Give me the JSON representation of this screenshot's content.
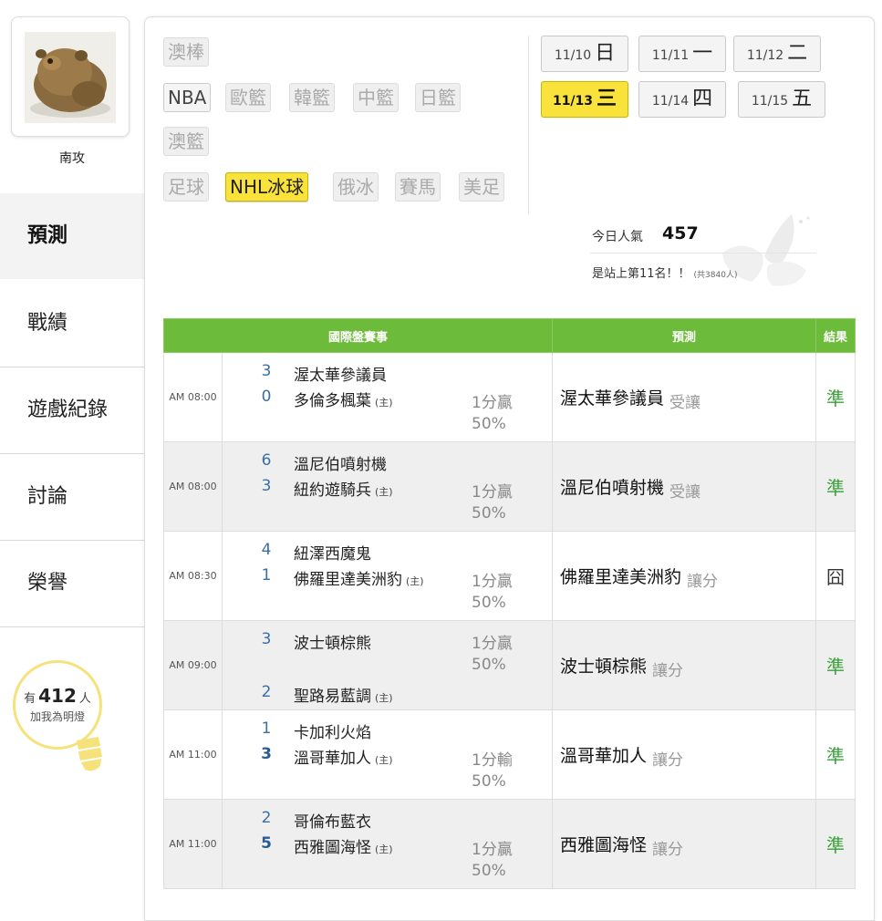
{
  "user": {
    "name": "南攻"
  },
  "nav": {
    "items": [
      {
        "label": "預測",
        "active": true
      },
      {
        "label": "戰績"
      },
      {
        "label": "遊戲紀錄"
      },
      {
        "label": "討論"
      },
      {
        "label": "榮譽"
      }
    ]
  },
  "fans": {
    "prefix": "有",
    "count": "412",
    "suffix": "人",
    "text": "加我為明燈"
  },
  "sports": {
    "tags": [
      {
        "label": "澳棒",
        "state": "off"
      },
      {
        "label": "NBA",
        "state": "on"
      },
      {
        "label": "歐籃",
        "state": "off"
      },
      {
        "label": "韓籃",
        "state": "off"
      },
      {
        "label": "中籃",
        "state": "off"
      },
      {
        "label": "日籃",
        "state": "off"
      },
      {
        "label": "澳籃",
        "state": "off"
      },
      {
        "label": "足球",
        "state": "off"
      },
      {
        "label": "NHL冰球",
        "state": "active"
      },
      {
        "label": "俄冰",
        "state": "off"
      },
      {
        "label": "賽馬",
        "state": "off"
      },
      {
        "label": "美足",
        "state": "off"
      }
    ]
  },
  "dates": [
    {
      "date": "11/10",
      "day": "日"
    },
    {
      "date": "11/11",
      "day": "一"
    },
    {
      "date": "11/12",
      "day": "二"
    },
    {
      "date": "11/13",
      "day": "三",
      "active": true
    },
    {
      "date": "11/14",
      "day": "四"
    },
    {
      "date": "11/15",
      "day": "五"
    }
  ],
  "popularity": {
    "label": "今日人氣",
    "value": "457",
    "rank_text": "是站上第11名！！",
    "rank_total": "(共3840人)"
  },
  "table": {
    "headers": {
      "event": "國際盤賽事",
      "prediction": "預測",
      "result": "結果"
    },
    "home_mark": "(主)",
    "rows": [
      {
        "time": "AM 08:00",
        "away_score": "3",
        "away": "渥太華參議員",
        "home_score": "0",
        "home": "多倫多楓葉",
        "line_a": "1分贏",
        "line_b": "50%",
        "pick": "渥太華參議員",
        "pick_type": "受讓",
        "result": "準"
      },
      {
        "time": "AM 08:00",
        "away_score": "6",
        "away": "溫尼伯噴射機",
        "home_score": "3",
        "home": "紐約遊騎兵",
        "line_a": "1分贏",
        "line_b": "50%",
        "pick": "溫尼伯噴射機",
        "pick_type": "受讓",
        "result": "準"
      },
      {
        "time": "AM 08:30",
        "away_score": "4",
        "away": "紐澤西魔鬼",
        "home_score": "1",
        "home": "佛羅里達美洲豹",
        "line_a": "1分贏",
        "line_b": "50%",
        "pick": "佛羅里達美洲豹",
        "pick_type": "讓分",
        "result": "囧"
      },
      {
        "time": "AM 09:00",
        "away_score": "3",
        "away": "波士頓棕熊",
        "home_score": "2",
        "home": "聖路易藍調",
        "line_a": "1分贏",
        "line_b": "50%",
        "pick": "波士頓棕熊",
        "pick_type": "讓分",
        "result": "準"
      },
      {
        "time": "AM 11:00",
        "away_score": "1",
        "away": "卡加利火焰",
        "home_score": "3",
        "home": "溫哥華加人",
        "line_a": "1分輸",
        "line_b": "50%",
        "pick": "溫哥華加人",
        "pick_type": "讓分",
        "result": "準"
      },
      {
        "time": "AM 11:00",
        "away_score": "2",
        "away": "哥倫布藍衣",
        "home_score": "5",
        "home": "西雅圖海怪",
        "line_a": "1分贏",
        "line_b": "50%",
        "pick": "西雅圖海怪",
        "pick_type": "讓分",
        "result": "準"
      }
    ]
  }
}
